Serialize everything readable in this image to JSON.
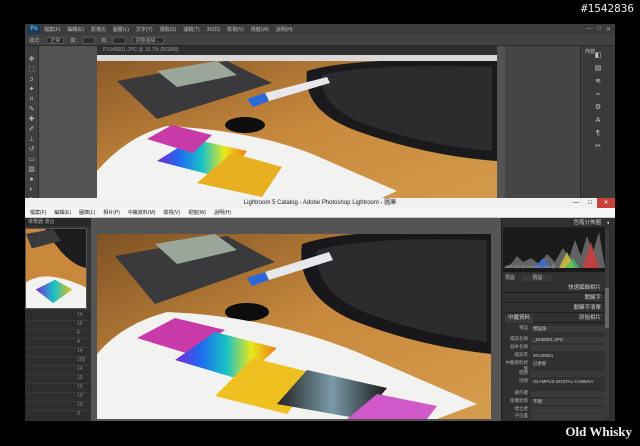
{
  "image_id": "#1542836",
  "watermark": "Old Whisky",
  "photoshop": {
    "logo": "Ps",
    "menus": [
      "檔案(F)",
      "編輯(E)",
      "影像(I)",
      "圖層(L)",
      "文字(Y)",
      "選取(S)",
      "濾鏡(T)",
      "3D(D)",
      "檢視(V)",
      "視窗(W)",
      "說明(H)"
    ],
    "options": [
      "樣式:",
      "正常",
      "寬:",
      "高:",
      "調整邊緣..."
    ],
    "tab_label": "P1040001.JPG @ 16.7% (RGB/8)",
    "right_label": "內容",
    "window_controls": [
      "—",
      "□",
      "✕"
    ],
    "tool_icons": [
      "move-icon",
      "marquee-icon",
      "lasso-icon",
      "magic-wand-icon",
      "crop-icon",
      "eyedropper-icon",
      "healing-icon",
      "brush-icon",
      "stamp-icon",
      "history-brush-icon",
      "eraser-icon",
      "gradient-icon",
      "blur-icon",
      "dodge-icon",
      "pen-icon",
      "type-icon",
      "path-select-icon",
      "shape-icon",
      "hand-icon",
      "zoom-icon"
    ],
    "panel_icons": [
      "adjust-icon",
      "layers-icon",
      "channels-icon",
      "paths-icon",
      "properties-icon",
      "character-icon",
      "paragraph-icon",
      "tools-icon"
    ]
  },
  "lightroom": {
    "title": "Lightroom 5 Catalog - Adobe Photoshop Lightroom - 圖庫",
    "window_controls": [
      "—",
      "□",
      "✕"
    ],
    "menus": [
      "檔案(F)",
      "編輯(E)",
      "圖庫(L)",
      "相片(P)",
      "中繼資料(M)",
      "檢視(V)",
      "視窗(W)",
      "說明(H)"
    ],
    "navigator_tab": "導覽器  適合",
    "left_numbers": [
      "14",
      "16",
      "6",
      "4",
      "14",
      "100",
      "14",
      "10",
      "13",
      "13",
      "10",
      "3"
    ],
    "panels": {
      "histogram": "色階分佈圖",
      "histogram_caption": "ISO 200   25 mm   f/5.6   1/60 秒",
      "quick_develop": "快速編輯相片",
      "keywords": "關鍵字",
      "keyword_list": "關鍵字清單",
      "metadata": "中繼資料",
      "original_photo": "原始相片"
    },
    "preset_label": "預設",
    "preset_value": "預設",
    "metadata_mode": "中繼資料",
    "metadata_default": "預設值",
    "metadata": [
      {
        "key": "檔案名稱",
        "value": "_1040001.JPG"
      },
      {
        "key": "副本名稱",
        "value": ""
      },
      {
        "key": "檔案夾",
        "value": "20140504"
      },
      {
        "key": "中繼資料狀態",
        "value": "已更新"
      },
      {
        "key": "標題",
        "value": ""
      },
      {
        "key": "說明",
        "value": ""
      },
      {
        "key": "相機",
        "value": "OLYMPUS DIGITAL CAMERA"
      },
      {
        "key": "著作權",
        "value": ""
      },
      {
        "key": "版權狀態",
        "value": "不明"
      },
      {
        "key": "建立者",
        "value": ""
      },
      {
        "key": "子位置",
        "value": ""
      }
    ]
  }
}
